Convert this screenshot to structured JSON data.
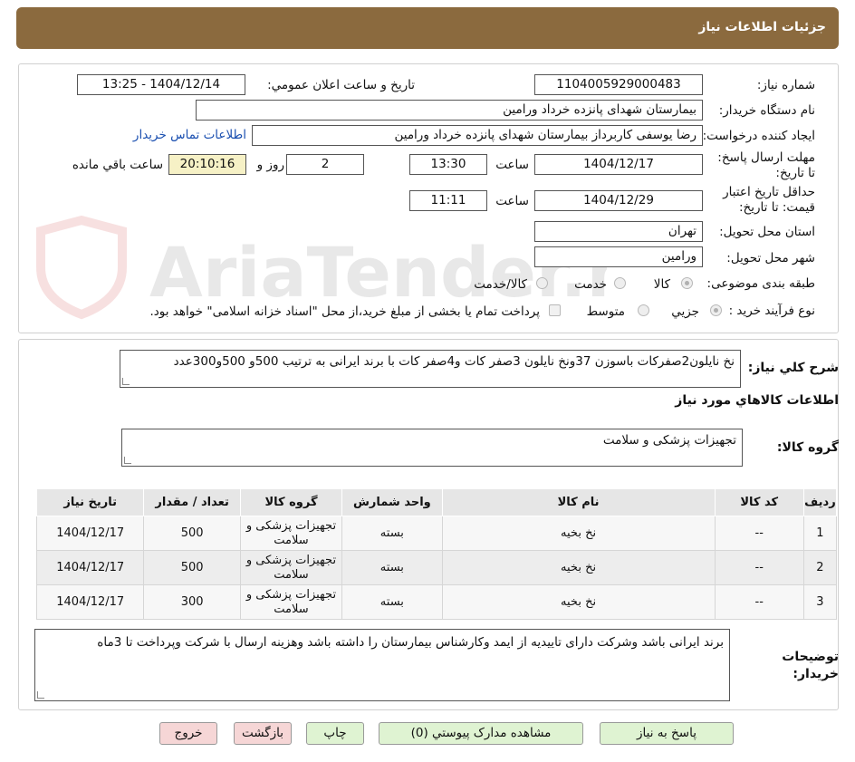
{
  "header": {
    "title": "جزئیات اطلاعات نیاز"
  },
  "form": {
    "need_number": {
      "label": "شماره نیاز:",
      "value": "1104005929000483"
    },
    "announce": {
      "label": "تاریخ و ساعت اعلان عمومي:",
      "value": "1404/12/14 - 13:25"
    },
    "buyer_org": {
      "label": "نام دستگاه خریدار:",
      "value": "بیمارستان شهدای پانزده خرداد ورامین"
    },
    "creator": {
      "label": "ایجاد کننده درخواست:",
      "value": "رضا یوسفی کاربرداز بیمارستان شهدای پانزده خرداد ورامین",
      "contact_link": "اطلاعات تماس خریدار"
    },
    "reply_deadline": {
      "label": "مهلت ارسال پاسخ: تا تاریخ:",
      "date": "1404/12/17",
      "time_label": "ساعت",
      "time": "13:30",
      "days": "2",
      "days_label": "روز و",
      "remaining": "20:10:16",
      "remaining_label": "ساعت باقي مانده"
    },
    "price_validity": {
      "label": "حداقل تاریخ اعتبار قیمت: تا تاریخ:",
      "date": "1404/12/29",
      "time_label": "ساعت",
      "time": "11:11"
    },
    "province": {
      "label": "استان محل تحویل:",
      "value": "تهران"
    },
    "city": {
      "label": "شهر محل تحویل:",
      "value": "ورامین"
    },
    "category": {
      "label": "طبقه بندی موضوعی:",
      "options": [
        "کالا",
        "خدمت",
        "کالا/خدمت"
      ],
      "selected": "کالا"
    },
    "process": {
      "label": "نوع فرآیند خرید :",
      "options": [
        "جزیي",
        "متوسط"
      ],
      "selected": "جزیي",
      "note": "پرداخت تمام یا بخشی از مبلغ خرید،از محل \"اسناد خزانه اسلامی\" خواهد بود."
    }
  },
  "watermark": {
    "text": "AriaTender.neT"
  },
  "summary": {
    "label": "شرح کلي نیاز:",
    "value": "نخ نایلون2صفرکات باسوزن 37ونخ نایلون 3صفر کات و4صفر کات با برند ایرانی به ترتیب 500و 500و300عدد"
  },
  "goods": {
    "section_title": "اطلاعات کالاهاي مورد نیاز",
    "group_label": "گروه کالا:",
    "group_value": "تجهیزات پزشکی و سلامت"
  },
  "table": {
    "headers": [
      "ردیف",
      "کد کالا",
      "نام کالا",
      "واحد شمارش",
      "گروه کالا",
      "تعداد / مقدار",
      "تاریخ نیاز"
    ],
    "rows": [
      [
        "1",
        "--",
        "نخ بخیه",
        "بسته",
        "تجهیزات پزشکی و سلامت",
        "500",
        "1404/12/17"
      ],
      [
        "2",
        "--",
        "نخ بخیه",
        "بسته",
        "تجهیزات پزشکی و سلامت",
        "500",
        "1404/12/17"
      ],
      [
        "3",
        "--",
        "نخ بخیه",
        "بسته",
        "تجهیزات پزشکی و سلامت",
        "300",
        "1404/12/17"
      ]
    ]
  },
  "buyer_notes": {
    "label": "توضیحات خریدار:",
    "value": "برند ایرانی باشد وشرکت دارای تاییدیه از ایمد وکارشناس بیمارستان را داشته باشد وهزینه ارسال با شرکت وپرداخت تا 3ماه"
  },
  "buttons": {
    "reply": "پاسخ به نیاز",
    "docs": "مشاهده مدارک پیوستي (0)",
    "print": "چاپ",
    "back": "بازگشت",
    "exit": "خروج"
  },
  "colors": {
    "header_bg": "#8b6a3e",
    "green_button": "#dff3d2",
    "pink_button": "#f6d6d6",
    "link": "#1a4fb0"
  }
}
